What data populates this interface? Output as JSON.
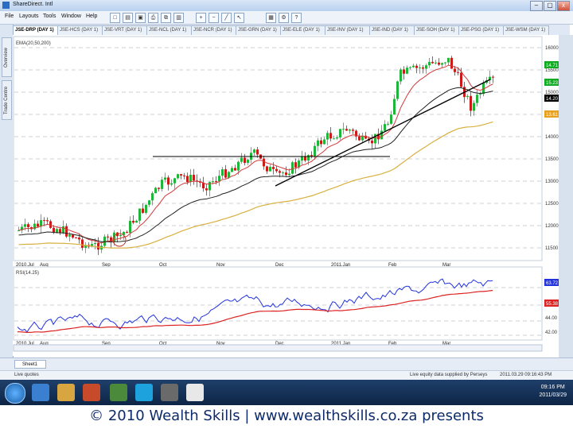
{
  "window": {
    "title": "ShareDirect. Intl",
    "minimize": "–",
    "maximize": "▢",
    "close": "x"
  },
  "menubar": {
    "items": [
      "File",
      "Layouts",
      "Tools",
      "Window",
      "Help"
    ],
    "toolbar_icons": [
      "new-icon",
      "open-icon",
      "save-icon",
      "print-icon",
      "copy-icon",
      "chart-icon",
      "zoom-in-icon",
      "zoom-out-icon",
      "line-tool-icon",
      "cursor-icon",
      "grid-icon",
      "settings-icon",
      "help-icon"
    ]
  },
  "tabs": [
    {
      "label": "JSE-DRP (DAY 1)",
      "active": true
    },
    {
      "label": "JSE-HCS (DAY 1)",
      "active": false
    },
    {
      "label": "JSE-VRT (DAY 1)",
      "active": false
    },
    {
      "label": "JSE-NCL (DAY 1)",
      "active": false
    },
    {
      "label": "JSE-NCR (DAY 1)",
      "active": false
    },
    {
      "label": "JSE-GRN (DAY 1)",
      "active": false
    },
    {
      "label": "JSE-ELE (DAY 1)",
      "active": false
    },
    {
      "label": "JSE-INV (DAY 1)",
      "active": false
    },
    {
      "label": "JSE-IND (DAY 1)",
      "active": false
    },
    {
      "label": "JSE-SOH (DAY 1)",
      "active": false
    },
    {
      "label": "JSE-PSG (DAY 1)",
      "active": false
    },
    {
      "label": "JSE-WSM (DAY 1)",
      "active": false
    }
  ],
  "side_tabs": [
    "Overview",
    "Trade Centre"
  ],
  "price_chart": {
    "legend": "EMA(20,50,200)",
    "y_labels": [
      "16000",
      "15500",
      "15000",
      "14500",
      "14000",
      "13500",
      "13000",
      "12500",
      "12000",
      "11500"
    ],
    "markers": [
      {
        "label": "14.71",
        "color": "#11aa22"
      },
      {
        "label": "15.23",
        "color": "#11aa22"
      },
      {
        "label": "14.20",
        "color": "#000000"
      },
      {
        "label": "13.61",
        "color": "#e8a020"
      }
    ],
    "x_labels": [
      "2010.Jul",
      "Aug",
      "Sep",
      "Oct",
      "Nov",
      "Dec",
      "2011.Jan",
      "Feb",
      "Mar"
    ]
  },
  "rsi_panel": {
    "label": "RSI(14.25)",
    "y_labels": [
      "50.00",
      "44.00",
      "42.00"
    ],
    "markers": [
      {
        "label": "63.72",
        "color": "#2233dd"
      },
      {
        "label": "55.38",
        "color": "#dd2222"
      }
    ],
    "x_labels": [
      "2010.Jul",
      "Aug",
      "Sep",
      "Oct",
      "Nov",
      "Dec",
      "2011.Jan",
      "Feb",
      "Mar"
    ]
  },
  "sheet_tab": "Sheet1",
  "status": {
    "left": "Live quotes",
    "right": "Live equity data supplied by Perseys",
    "timestamp": "2011.03.29 09:16:43 PM"
  },
  "clock": {
    "time": "09:16 PM",
    "date": "2011/03/29"
  },
  "footer": "© 2010 Wealth Skills | www.wealthskills.co.za presents",
  "colors": {
    "up_candle": "#1fb43a",
    "down_candle": "#cc1a1a",
    "ema_fast": "#d23a3a",
    "ema_mid": "#222222",
    "ema_slow": "#d8b040",
    "rsi": "#2233dd",
    "rsi_signal": "#dd2222"
  }
}
